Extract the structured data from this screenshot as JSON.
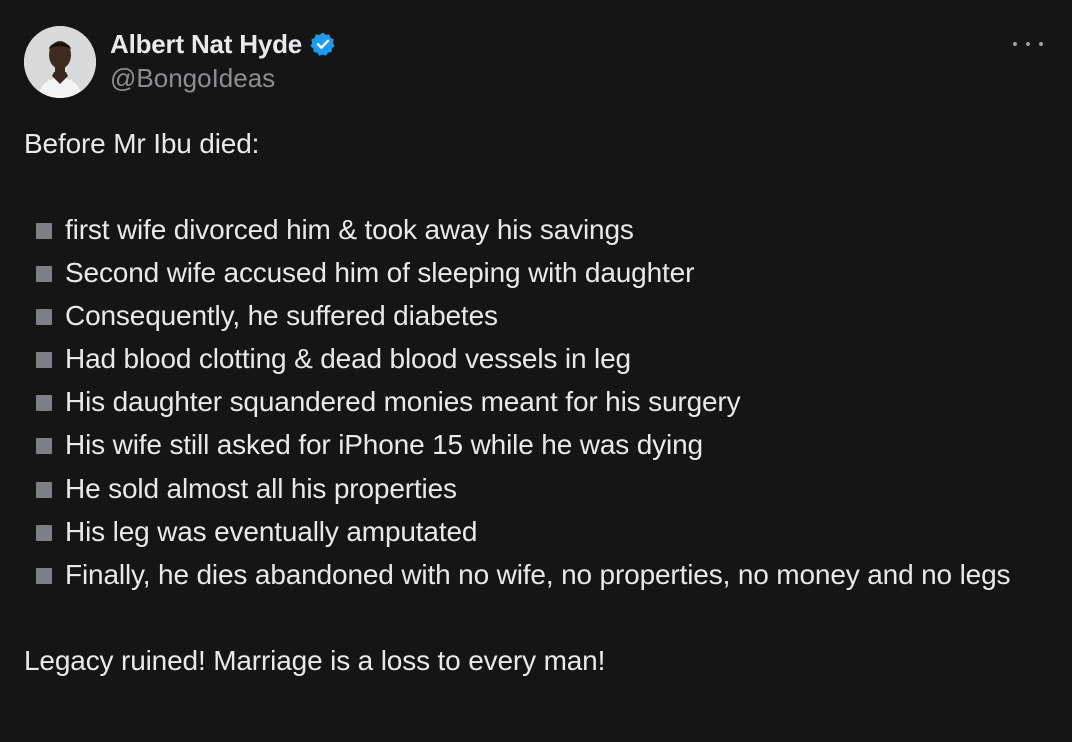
{
  "author": {
    "display_name": "Albert Nat Hyde",
    "handle": "@BongoIdeas",
    "verified": true,
    "avatar_icon": "profile-photo",
    "verified_icon": "verified-badge-icon"
  },
  "menu": {
    "icon": "more-options-icon"
  },
  "tweet": {
    "intro": "Before Mr Ibu died:",
    "bullet_icon": "gray-square-bullet",
    "bullets": [
      "first wife divorced him & took away his savings",
      "Second wife accused him of sleeping with daughter",
      "Consequently, he suffered diabetes",
      "Had blood clotting & dead blood vessels in leg",
      "His daughter squandered monies meant for his surgery",
      "His wife still asked for iPhone 15 while he was dying",
      "He sold almost all his properties",
      "His leg was eventually amputated",
      "Finally, he dies abandoned with no wife, no properties, no money and no legs"
    ],
    "outro": "Legacy ruined! Marriage is a loss to every man!"
  },
  "colors": {
    "background": "#151515",
    "text": "#e7e9ea",
    "secondary_text": "#8b8f94",
    "verified_blue": "#1d9bf0",
    "bullet_gray": "#7c7f83"
  }
}
